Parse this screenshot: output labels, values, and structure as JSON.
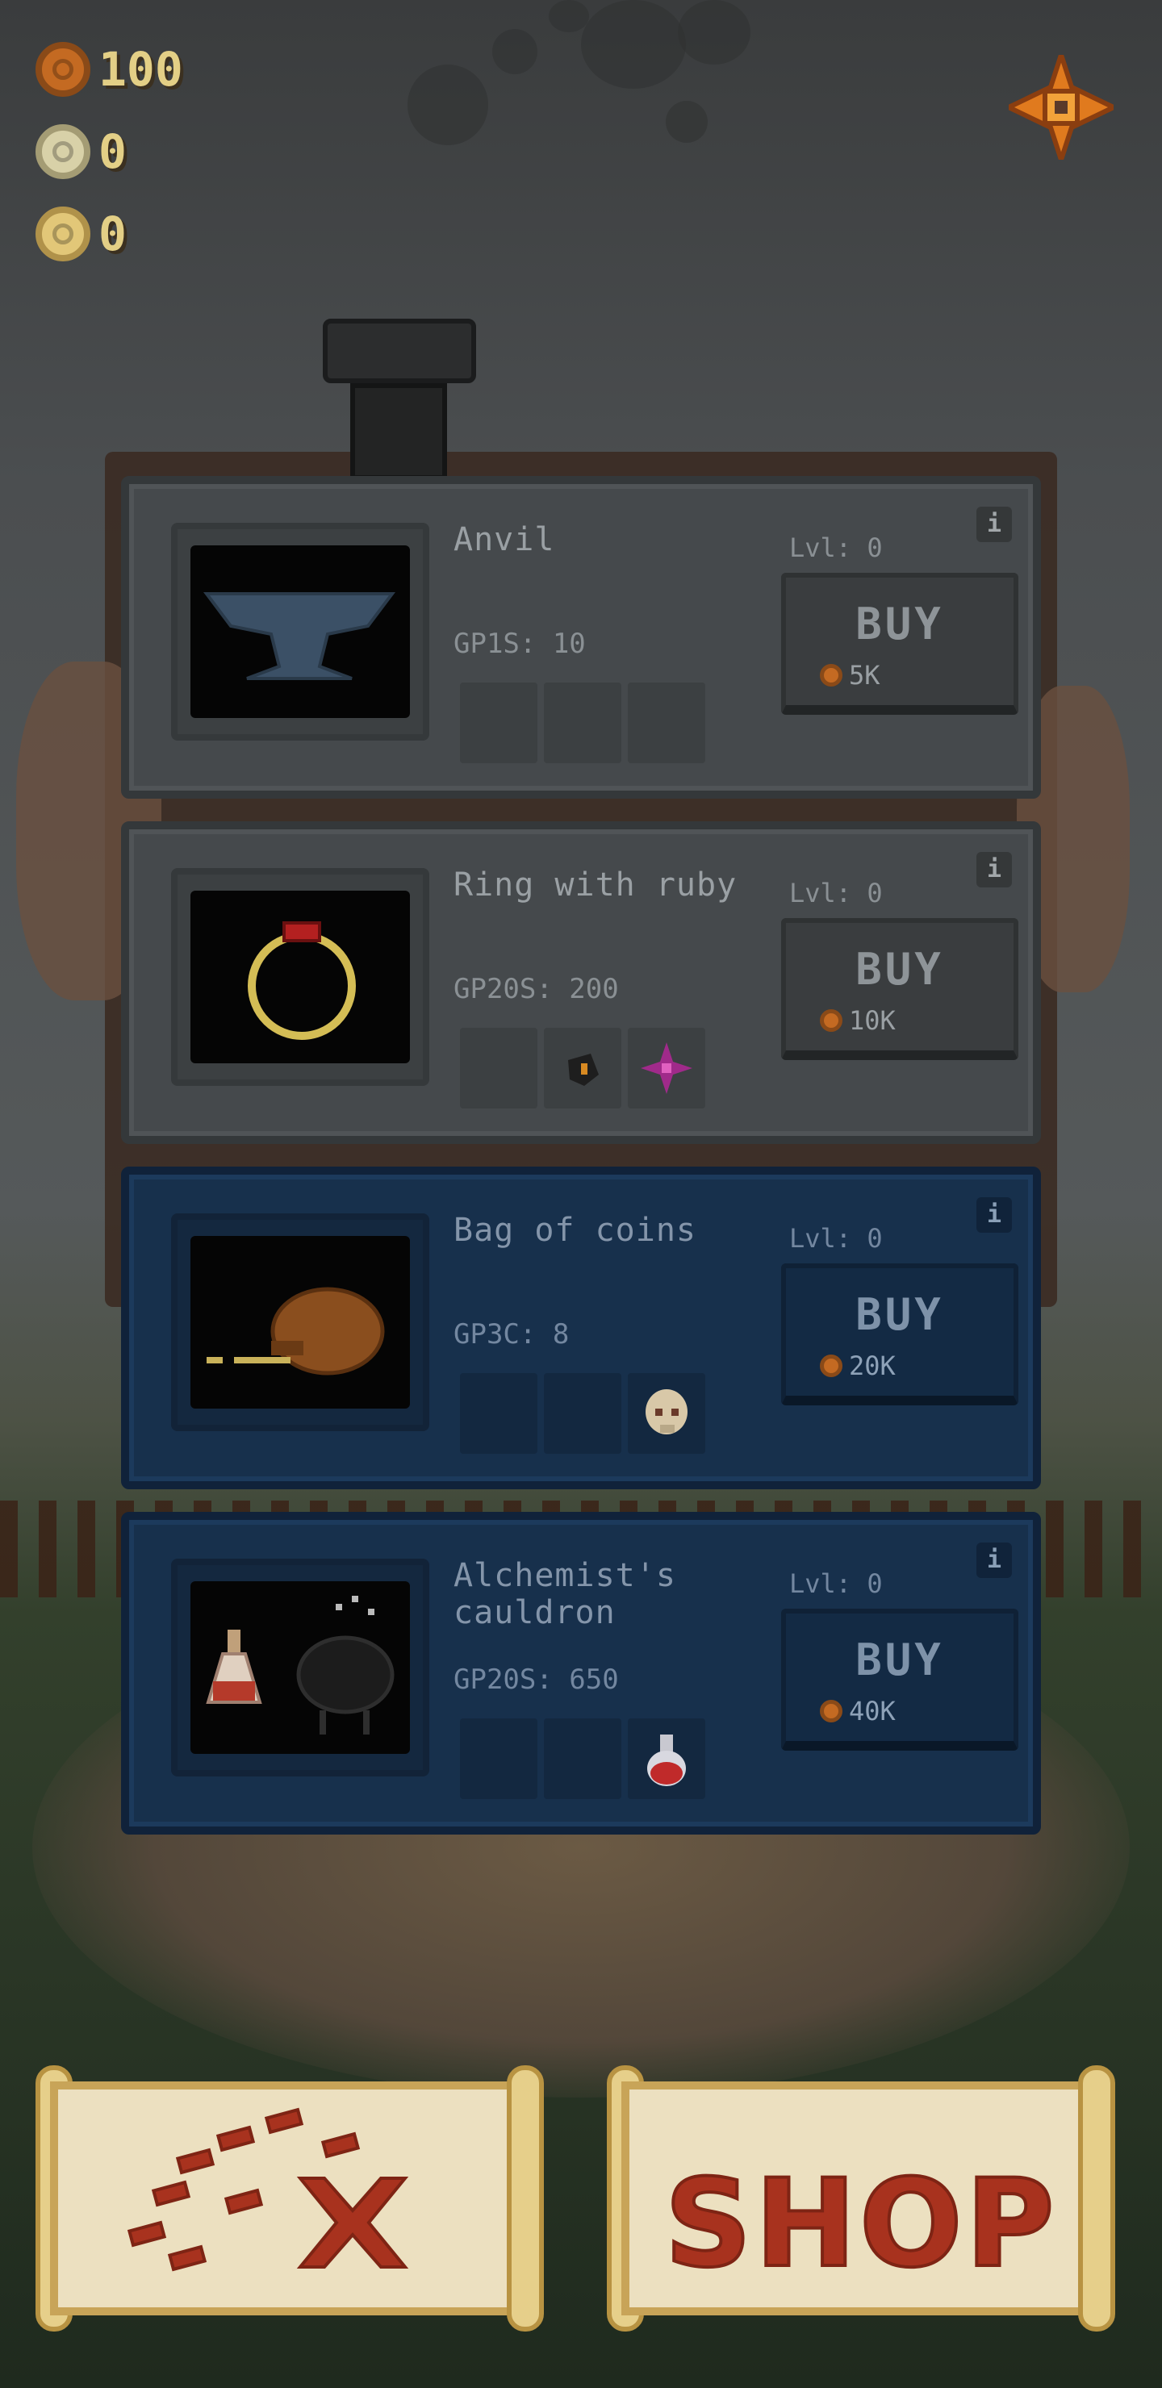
{
  "currencies": [
    {
      "type": "bronze",
      "icon": "bronze-coin-icon",
      "value": "100"
    },
    {
      "type": "silver",
      "icon": "silver-coin-icon",
      "value": "0"
    },
    {
      "type": "gold",
      "icon": "gold-coin-icon",
      "value": "0"
    }
  ],
  "settings_icon": "gear-icon",
  "items": [
    {
      "name": "Anvil",
      "gps": "GP1S: 10",
      "level": "Lvl: 0",
      "buy_label": "BUY",
      "price": "5K",
      "info": "i",
      "theme": "gray"
    },
    {
      "name": "Ring with ruby",
      "gps": "GP20S: 200",
      "level": "Lvl: 0",
      "buy_label": "BUY",
      "price": "10K",
      "info": "i",
      "theme": "gray"
    },
    {
      "name": "Bag of coins",
      "gps": "GP3C: 8",
      "level": "Lvl: 0",
      "buy_label": "BUY",
      "price": "20K",
      "info": "i",
      "theme": "blue"
    },
    {
      "name": "Alchemist's cauldron",
      "gps": "GP20S: 650",
      "level": "Lvl: 0",
      "buy_label": "BUY",
      "price": "40K",
      "info": "i",
      "theme": "blue"
    }
  ],
  "nav": {
    "map_icon": "treasure-map-icon",
    "shop_label": "SHOP"
  },
  "colors": {
    "coin_text": "#e3cf86",
    "shop_text": "#a8321e",
    "gray_card": "#45494c",
    "blue_card": "#17304c"
  }
}
